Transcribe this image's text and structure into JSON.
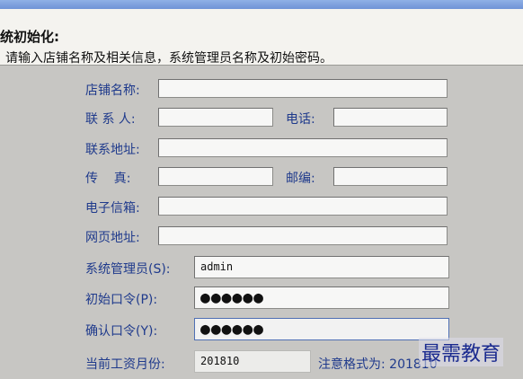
{
  "section": {
    "title": "统初始化:",
    "description": "请输入店铺名称及相关信息，系统管理员名称及初始密码。"
  },
  "form": {
    "shop_name": {
      "label": "店铺名称:",
      "value": ""
    },
    "contact": {
      "label": "联 系 人:",
      "value": ""
    },
    "phone": {
      "label": "电话:",
      "value": ""
    },
    "address": {
      "label": "联系地址:",
      "value": ""
    },
    "fax": {
      "label": "传    真:",
      "value": ""
    },
    "zip": {
      "label": "邮编:",
      "value": ""
    },
    "email": {
      "label": "电子信箱:",
      "value": ""
    },
    "website": {
      "label": "网页地址:",
      "value": ""
    },
    "admin": {
      "label": "系统管理员(S):",
      "value": "admin"
    },
    "init_password": {
      "label": "初始口令(P):",
      "value": "●●●●●●"
    },
    "confirm_password": {
      "label": "确认口令(Y):",
      "value": "●●●●●●"
    },
    "month": {
      "label": "当前工资月份:",
      "value": "201810",
      "hint": "注意格式为: 201810"
    }
  },
  "watermark": "最需教育"
}
